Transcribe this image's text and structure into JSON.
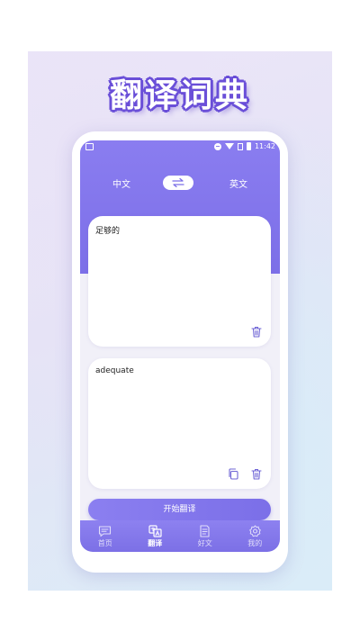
{
  "poster": {
    "headline": "翻译词典"
  },
  "status": {
    "time": "11:42"
  },
  "language": {
    "source": "中文",
    "target": "英文",
    "swap_icon": "swap-arrows-icon"
  },
  "source_card": {
    "text": "足够的",
    "delete_icon": "trash-icon"
  },
  "target_card": {
    "text": "adequate",
    "copy_icon": "copy-icon",
    "delete_icon": "trash-icon"
  },
  "translate_button": {
    "label": "开始翻译"
  },
  "tabs": [
    {
      "label": "首页",
      "icon": "chat-bubble-icon",
      "active": false
    },
    {
      "label": "翻译",
      "icon": "translate-icon",
      "active": true
    },
    {
      "label": "好文",
      "icon": "document-icon",
      "active": false
    },
    {
      "label": "我的",
      "icon": "gear-icon",
      "active": false
    }
  ],
  "colors": {
    "primary": "#7c6fe8",
    "screen_bg": "#f1f0f8",
    "icon": "#6f65d6"
  }
}
